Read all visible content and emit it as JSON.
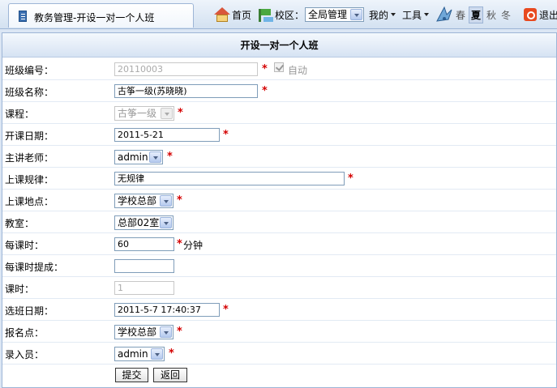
{
  "tab": {
    "title": "教务管理-开设一对一个人班"
  },
  "toolbar": {
    "home_label": "首页",
    "campus_label": "校区：",
    "campus_value": "全局管理",
    "mine_label": "我的",
    "tools_label": "工具",
    "seasons": [
      "春",
      "夏",
      "秋",
      "冬"
    ],
    "selected_season": "夏",
    "exit_label": "退出"
  },
  "form": {
    "title": "开设一对一个人班",
    "required_mark": "*",
    "class_code": {
      "label": "班级编号：",
      "value": "20110003",
      "auto_label": "自动"
    },
    "class_name": {
      "label": "班级名称：",
      "value": "古筝一级(苏晓晓)"
    },
    "course": {
      "label": "课程：",
      "value": "古筝一级"
    },
    "start_date": {
      "label": "开课日期：",
      "value": "2011-5-21"
    },
    "teacher": {
      "label": "主讲老师：",
      "value": "admin"
    },
    "schedule": {
      "label": "上课规律：",
      "value": "无规律"
    },
    "location": {
      "label": "上课地点：",
      "value": "学校总部"
    },
    "classroom": {
      "label": "教室：",
      "value": "总部02室"
    },
    "hours_per_class": {
      "label": "每课时：",
      "value": "60",
      "unit": "分钟"
    },
    "commission": {
      "label": "每课时提成：",
      "value": ""
    },
    "lessons": {
      "label": "课时：",
      "value": "1"
    },
    "select_date": {
      "label": "选班日期：",
      "value": "2011-5-7 17:40:37"
    },
    "signup_site": {
      "label": "报名点：",
      "value": "学校总部"
    },
    "entered_by": {
      "label": "录入员：",
      "value": "admin"
    },
    "submit_label": "提交",
    "back_label": "返回"
  },
  "colors": {
    "required": "#d40000",
    "header_border": "#9db5d6",
    "background": "#dbe6f4"
  }
}
